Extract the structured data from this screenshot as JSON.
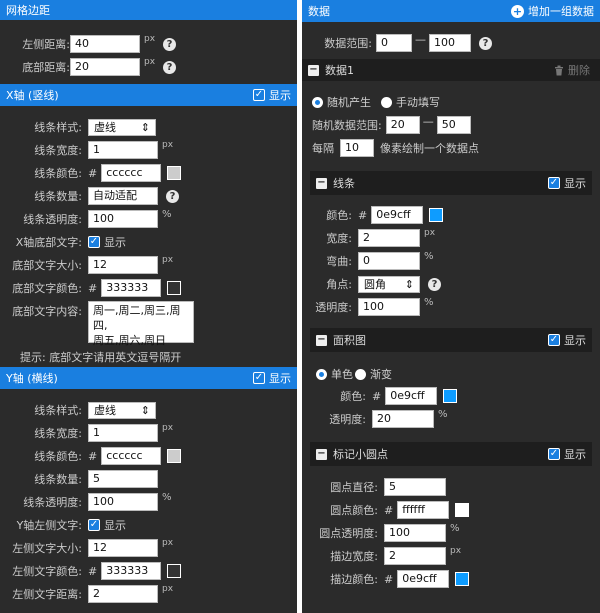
{
  "grid": {
    "title": "网格边距",
    "left_label": "左侧距离:",
    "left_value": "40",
    "bottom_label": "底部距离:",
    "bottom_value": "20",
    "unit": "px"
  },
  "xaxis": {
    "title": "X轴 (竖线)",
    "show": "显示",
    "style_label": "线条样式:",
    "style_value": "虚线",
    "width_label": "线条宽度:",
    "width_value": "1",
    "color_label": "线条颜色:",
    "color_value": "cccccc",
    "count_label": "线条数量:",
    "count_value": "自动适配",
    "opacity_label": "线条透明度:",
    "opacity_value": "100",
    "bottom_text_label": "X轴底部文字:",
    "bottom_text_show": "显示",
    "font_size_label": "底部文字大小:",
    "font_size_value": "12",
    "font_color_label": "底部文字颜色:",
    "font_color_value": "333333",
    "content_label": "底部文字内容:",
    "content_line1": "周一,周二,周三,周四,",
    "content_line2": "周五,周六,周日",
    "hint": "提示: 底部文字请用英文逗号隔开"
  },
  "yaxis": {
    "title": "Y轴 (横线)",
    "show": "显示",
    "style_label": "线条样式:",
    "style_value": "虚线",
    "width_label": "线条宽度:",
    "width_value": "1",
    "color_label": "线条颜色:",
    "color_value": "cccccc",
    "count_label": "线条数量:",
    "count_value": "5",
    "opacity_label": "线条透明度:",
    "opacity_value": "100",
    "left_text_label": "Y轴左侧文字:",
    "left_text_show": "显示",
    "font_size_label": "左侧文字大小:",
    "font_size_value": "12",
    "font_color_label": "左侧文字颜色:",
    "font_color_value": "333333",
    "distance_label": "左侧文字距离:",
    "distance_value": "2"
  },
  "data": {
    "title": "数据",
    "add_label": "增加一组数据",
    "range_label": "数据范围:",
    "range_min": "0",
    "range_max": "100",
    "dataset": "数据1",
    "delete_label": "删除",
    "random_label": "随机产生",
    "manual_label": "手动填写",
    "random_range_label": "随机数据范围:",
    "random_min": "20",
    "random_max": "50",
    "every_label": "每隔",
    "every_value": "10",
    "every_suffix": "像素绘制一个数据点"
  },
  "line": {
    "title": "线条",
    "show": "显示",
    "color_label": "颜色:",
    "color_value": "0e9cff",
    "width_label": "宽度:",
    "width_value": "2",
    "curve_label": "弯曲:",
    "curve_value": "0",
    "corner_label": "角点:",
    "corner_value": "圆角",
    "opacity_label": "透明度:",
    "opacity_value": "100"
  },
  "area": {
    "title": "面积图",
    "show": "显示",
    "single_label": "单色",
    "gradient_label": "渐变",
    "color_label": "颜色:",
    "color_value": "0e9cff",
    "opacity_label": "透明度:",
    "opacity_value": "20"
  },
  "dots": {
    "title": "标记小圆点",
    "show": "显示",
    "diameter_label": "圆点直径:",
    "diameter_value": "5",
    "color_label": "圆点颜色:",
    "color_value": "ffffff",
    "opacity_label": "圆点透明度:",
    "opacity_value": "100",
    "stroke_width_label": "描边宽度:",
    "stroke_width_value": "2",
    "stroke_color_label": "描边颜色:",
    "stroke_color_value": "0e9cff"
  },
  "symbols": {
    "hash": "#",
    "px": "px",
    "percent": "%",
    "dash": "—",
    "check": "✓",
    "question": "?",
    "minus": "−",
    "plus": "+",
    "caret": "▾",
    "updown": "⇕"
  },
  "colors": {
    "accent": "#1a7fe0",
    "panel": "#2b2b2b",
    "sub_header": "#1e1e1e",
    "blue_swatch": "#0e9cff",
    "white_swatch": "#ffffff",
    "gray_swatch": "#cccccc",
    "dark_swatch": "#333333"
  }
}
